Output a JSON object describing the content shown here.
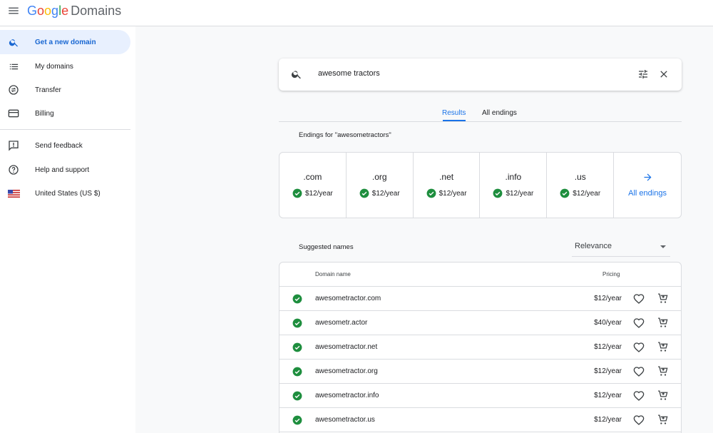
{
  "header": {
    "logo_google": "Google",
    "logo_product": "Domains"
  },
  "sidebar": {
    "items": [
      {
        "label": "Get a new domain",
        "icon": "search-icon"
      },
      {
        "label": "My domains",
        "icon": "list-icon"
      },
      {
        "label": "Transfer",
        "icon": "transfer-icon"
      },
      {
        "label": "Billing",
        "icon": "credit-card-icon"
      },
      {
        "label": "Send feedback",
        "icon": "feedback-icon"
      },
      {
        "label": "Help and support",
        "icon": "help-icon"
      },
      {
        "label": "United States (US $)",
        "icon": "us-flag-icon"
      }
    ]
  },
  "search": {
    "query": "awesome tractors"
  },
  "tabs": [
    {
      "label": "Results"
    },
    {
      "label": "All endings"
    }
  ],
  "endings": {
    "header": "Endings for \"awesometractors\"",
    "items": [
      {
        "tld": ".com",
        "price": "$12/year"
      },
      {
        "tld": ".org",
        "price": "$12/year"
      },
      {
        "tld": ".net",
        "price": "$12/year"
      },
      {
        "tld": ".info",
        "price": "$12/year"
      },
      {
        "tld": ".us",
        "price": "$12/year"
      }
    ],
    "all_label": "All endings"
  },
  "suggested": {
    "header": "Suggested names",
    "sort_value": "Relevance",
    "col_domain": "Domain name",
    "col_pricing": "Pricing",
    "rows": [
      {
        "name": "awesometractor.com",
        "price": "$12/year"
      },
      {
        "name": "awesometr.actor",
        "price": "$40/year"
      },
      {
        "name": "awesometractor.net",
        "price": "$12/year"
      },
      {
        "name": "awesometractor.org",
        "price": "$12/year"
      },
      {
        "name": "awesometractor.info",
        "price": "$12/year"
      },
      {
        "name": "awesometractor.us",
        "price": "$12/year"
      }
    ]
  },
  "colors": {
    "accent": "#1a73e8",
    "available": "#1e8e3e",
    "active_nav_bg": "#e8f0fe"
  }
}
